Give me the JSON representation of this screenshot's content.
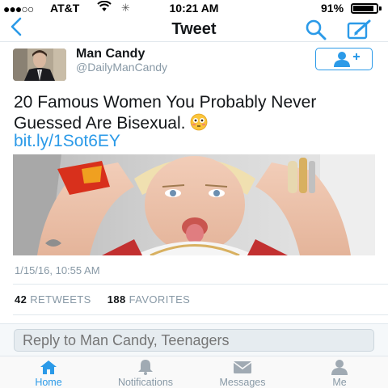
{
  "status_bar": {
    "signal": "●●●○○",
    "carrier": "AT&T",
    "time": "10:21 AM",
    "battery": "91%",
    "battery_level": 0.91
  },
  "nav": {
    "back_icon": "chevron-left-icon",
    "title": "Tweet",
    "search_icon": "search-icon",
    "compose_icon": "compose-icon"
  },
  "tweet": {
    "author_name": "Man Candy",
    "author_handle": "@DailyManCandy",
    "follow_icon": "add-user-icon",
    "text": "20 Famous Women You Probably Never Guessed Are Bisexual.",
    "emoji": "flushed-face",
    "link": "bit.ly/1Sot6EY",
    "timestamp": "1/15/16, 10:55 AM",
    "retweets_count": "42",
    "retweets_label": "RETWEETS",
    "favorites_count": "188",
    "favorites_label": "FAVORITES"
  },
  "reply": {
    "placeholder": "Reply to Man Candy, Teenagers"
  },
  "tabs": [
    {
      "label": "Home",
      "icon": "home-icon",
      "active": true
    },
    {
      "label": "Notifications",
      "icon": "bell-icon",
      "active": false
    },
    {
      "label": "Messages",
      "icon": "envelope-icon",
      "active": false
    },
    {
      "label": "Me",
      "icon": "person-icon",
      "active": false
    }
  ],
  "colors": {
    "accent": "#2b9ae8",
    "muted": "#8899a6",
    "text": "#14171a"
  }
}
